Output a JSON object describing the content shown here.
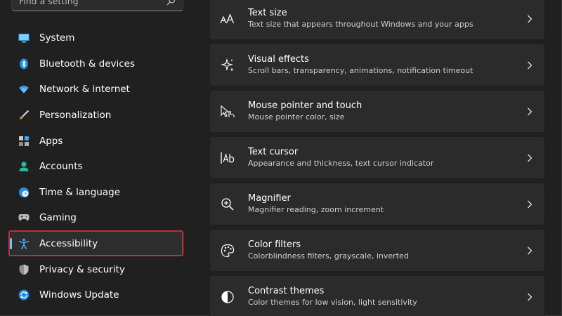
{
  "search": {
    "placeholder": "Find a setting"
  },
  "sidebar": {
    "items": [
      {
        "label": "System",
        "icon": "monitor-icon"
      },
      {
        "label": "Bluetooth & devices",
        "icon": "bluetooth-icon"
      },
      {
        "label": "Network & internet",
        "icon": "wifi-icon"
      },
      {
        "label": "Personalization",
        "icon": "brush-icon"
      },
      {
        "label": "Apps",
        "icon": "apps-icon"
      },
      {
        "label": "Accounts",
        "icon": "person-icon"
      },
      {
        "label": "Time & language",
        "icon": "globe-clock-icon"
      },
      {
        "label": "Gaming",
        "icon": "gamepad-icon"
      },
      {
        "label": "Accessibility",
        "icon": "accessibility-icon",
        "selected": true
      },
      {
        "label": "Privacy & security",
        "icon": "shield-icon"
      },
      {
        "label": "Windows Update",
        "icon": "update-icon"
      }
    ]
  },
  "main": {
    "cards": [
      {
        "title": "Text size",
        "subtitle": "Text size that appears throughout Windows and your apps",
        "icon": "text-size-icon"
      },
      {
        "title": "Visual effects",
        "subtitle": "Scroll bars, transparency, animations, notification timeout",
        "icon": "sparkle-icon"
      },
      {
        "title": "Mouse pointer and touch",
        "subtitle": "Mouse pointer color, size",
        "icon": "pointer-touch-icon"
      },
      {
        "title": "Text cursor",
        "subtitle": "Appearance and thickness, text cursor indicator",
        "icon": "text-cursor-icon"
      },
      {
        "title": "Magnifier",
        "subtitle": "Magnifier reading, zoom increment",
        "icon": "magnifier-icon"
      },
      {
        "title": "Color filters",
        "subtitle": "Colorblindness filters, grayscale, inverted",
        "icon": "palette-icon"
      },
      {
        "title": "Contrast themes",
        "subtitle": "Color themes for low vision, light sensitivity",
        "icon": "contrast-icon"
      }
    ]
  },
  "colors": {
    "accent": "#60cdff",
    "highlight": "#c42b3a",
    "background": "#202020",
    "card": "#2b2b2b"
  }
}
